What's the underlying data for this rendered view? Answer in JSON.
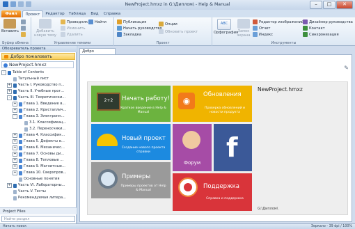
{
  "window": {
    "title": "NewProject.hmxz in G:\\Диплом\\ - Help & Manual",
    "controls": [
      "–",
      "□",
      "✕"
    ]
  },
  "ribbon_tabs": [
    "Файл",
    "Проект",
    "Редактор",
    "Таблица",
    "Вид",
    "Справка"
  ],
  "ribbon": {
    "clipboard": {
      "paste": "Вставить",
      "label": "Буфер обмена"
    },
    "topics": {
      "add_topic": "Добавить новую тему",
      "explorer": "Проводник",
      "change": "Изменить",
      "find": "Найти",
      "delete": "Удалить",
      "label": "Управление темами"
    },
    "project": {
      "publish": "Публикация",
      "start_guide": "Начать руководство",
      "bookmark": "Закладка",
      "options": "Опции",
      "update_project": "Обновить проект",
      "label": "Проект"
    },
    "tools": {
      "spelling": "Орфография",
      "lock": "Замок экрана",
      "image_editor": "Редактор изображений",
      "report": "Отчет",
      "index": "Индекс",
      "guide_designer": "Дизайнер руководства",
      "contact": "Контакт",
      "sync": "Синхронизация",
      "label": "Инструменты"
    }
  },
  "left_panel": {
    "header": "Обозреватель проекта",
    "welcome": "Добро пожаловать",
    "project": "NewProject.hmxz",
    "tree": [
      {
        "level": 1,
        "label": "Table of Contents",
        "expander": "-",
        "icon": "toc"
      },
      {
        "level": 2,
        "label": "Титульный лист",
        "expander": "",
        "icon": "page"
      },
      {
        "level": 2,
        "label": "Часть I. Руководство п...",
        "expander": "+",
        "icon": "book"
      },
      {
        "level": 2,
        "label": "Часть II. Учебные прог...",
        "expander": "+",
        "icon": "book"
      },
      {
        "level": 2,
        "label": "Часть III. Теоретически...",
        "expander": "-",
        "icon": "book"
      },
      {
        "level": 3,
        "label": "Глава 1. Введение в...",
        "expander": "+",
        "icon": "chapter"
      },
      {
        "level": 3,
        "label": "Глава 2. Кристаллич...",
        "expander": "+",
        "icon": "chapter"
      },
      {
        "level": 3,
        "label": "Глава 3. Электронн...",
        "expander": "-",
        "icon": "chapter"
      },
      {
        "level": 4,
        "label": "3.1. Классификац...",
        "expander": "",
        "icon": "page"
      },
      {
        "level": 4,
        "label": "3.2. Переносчики...",
        "expander": "",
        "icon": "page"
      },
      {
        "level": 3,
        "label": "Глава 4. Классифик...",
        "expander": "+",
        "icon": "chapter"
      },
      {
        "level": 3,
        "label": "Глава 5. Дефекты в...",
        "expander": "+",
        "icon": "chapter"
      },
      {
        "level": 3,
        "label": "Глава 6. Механичес...",
        "expander": "+",
        "icon": "chapter"
      },
      {
        "level": 3,
        "label": "Глава 7. Основы ди...",
        "expander": "+",
        "icon": "chapter"
      },
      {
        "level": 3,
        "label": "Глава 8. Тепловые ...",
        "expander": "+",
        "icon": "chapter"
      },
      {
        "level": 3,
        "label": "Глава 9. Магнитные...",
        "expander": "+",
        "icon": "chapter"
      },
      {
        "level": 3,
        "label": "Глава 10. Сверхпров...",
        "expander": "+",
        "icon": "chapter"
      },
      {
        "level": 3,
        "label": "Основные понятия",
        "expander": "",
        "icon": "page"
      },
      {
        "level": 2,
        "label": "Часть VI. Лабораторны...",
        "expander": "+",
        "icon": "book"
      },
      {
        "level": 2,
        "label": "Часть V. Тесты",
        "expander": "",
        "icon": "page"
      },
      {
        "level": 2,
        "label": "Рекомендуемая литера...",
        "expander": "",
        "icon": "page"
      }
    ],
    "files": "Project Files",
    "search_placeholder": "Найти раздел"
  },
  "document_tab": "Добро пожаловать",
  "welcome": {
    "project_name": "NewProject.hmxz",
    "project_path": "G:\\Диплом\\",
    "tiles": [
      {
        "title": "Начать работу!",
        "desc": "Краткое введение в Help & Manual",
        "color": "#6cb33f",
        "icon": "chalkboard-icon"
      },
      {
        "title": "Обновления",
        "desc": "Проверка обновлений и новости продукта",
        "color": "#f0b400",
        "icon": "rss-icon"
      },
      {
        "title": "Новый проект",
        "desc": "Создание нового проекта справки",
        "color": "#1c8ae0",
        "icon": "hardhat-icon"
      },
      {
        "title": "Форум",
        "desc": "",
        "color": "#a64ca6",
        "icon": "forum-people-icon"
      },
      {
        "title": "f",
        "desc": "",
        "color": "#3b5998",
        "icon": "facebook-icon"
      },
      {
        "title": "Примеры",
        "desc": "Примеры проектов от Help & Manual",
        "color": "#9a9a9a",
        "icon": "magnifier-icon"
      },
      {
        "title": "Поддержка",
        "desc": "Справка и поддержка",
        "color": "#d9343a",
        "icon": "lifebuoy-icon"
      }
    ]
  },
  "statusbar": {
    "text": "Начать поиск",
    "zoom": "Зеркало - 39 dpi / 100%"
  }
}
